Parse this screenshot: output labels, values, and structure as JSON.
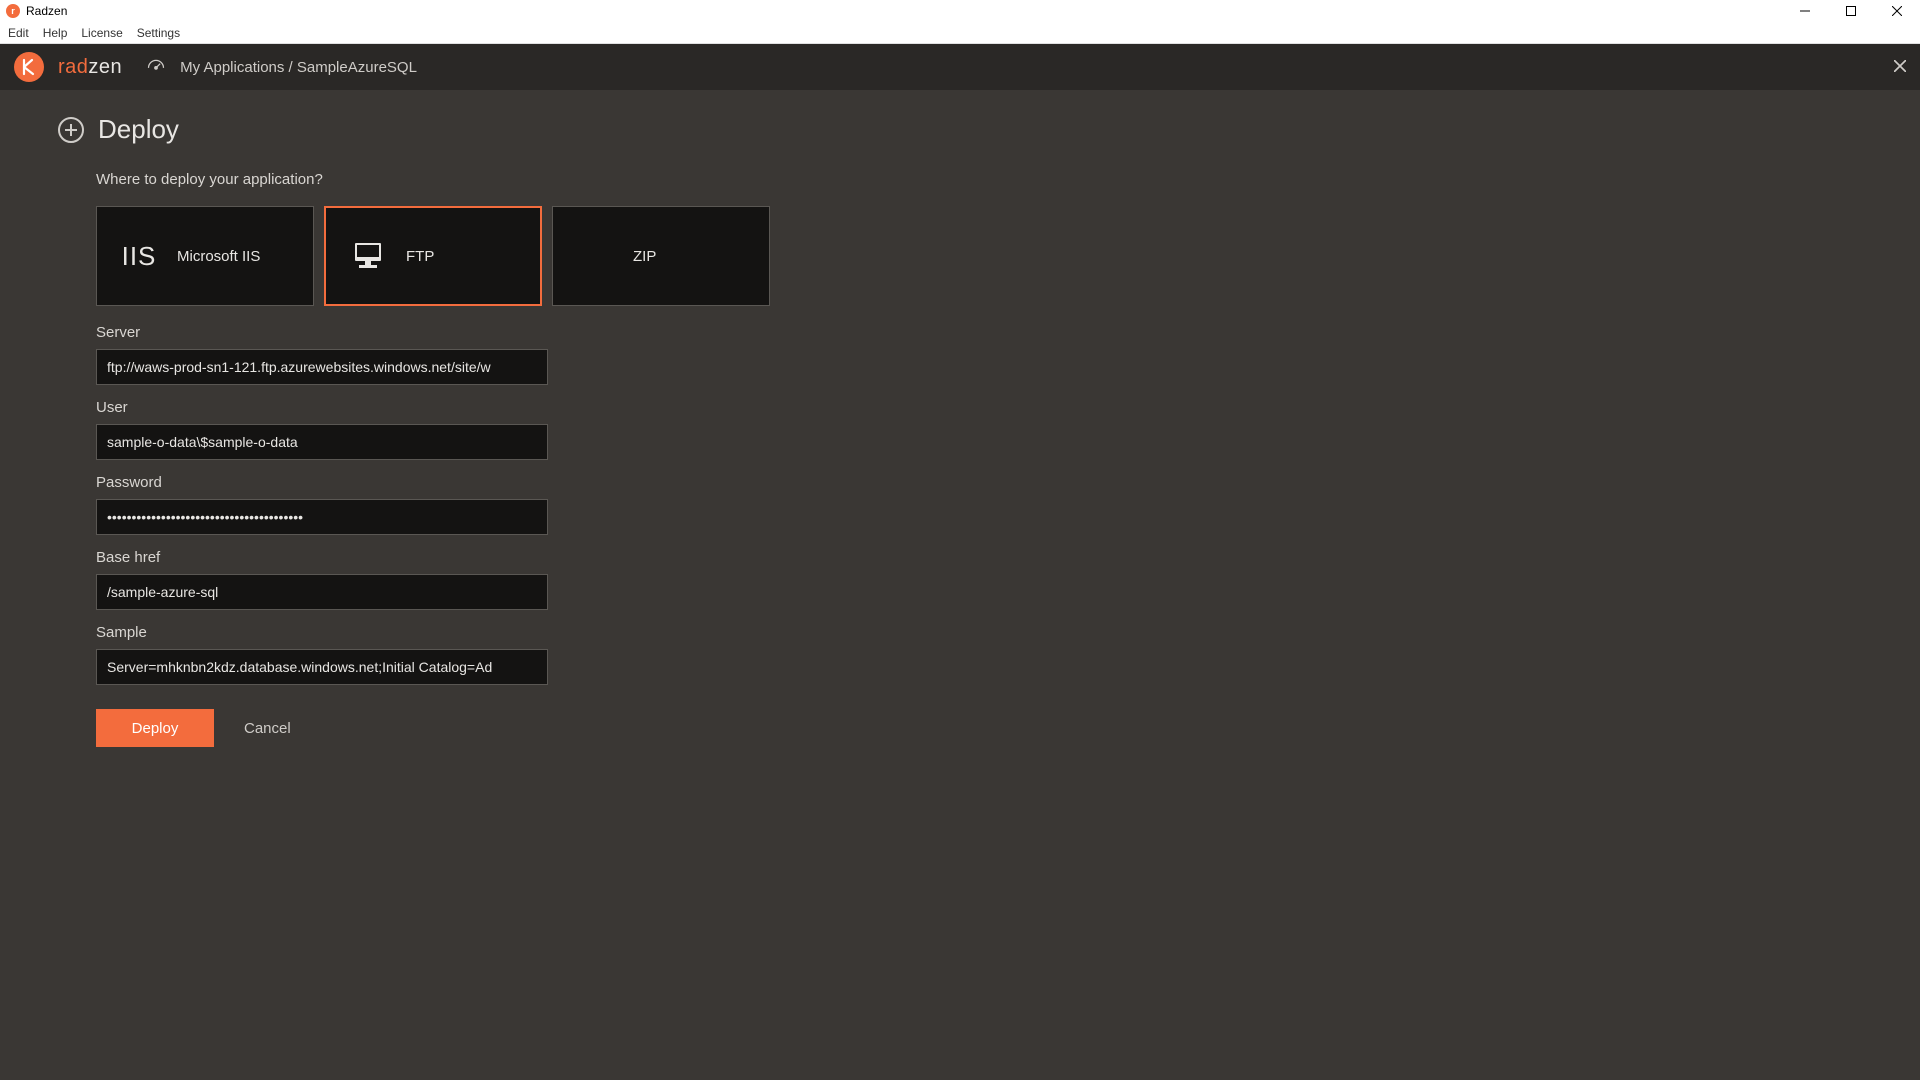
{
  "window": {
    "title": "Radzen"
  },
  "menubar": {
    "items": [
      "Edit",
      "Help",
      "License",
      "Settings"
    ]
  },
  "header": {
    "logo_rad": "rad",
    "logo_zen": "zen",
    "breadcrumb": "My Applications / SampleAzureSQL"
  },
  "page": {
    "title": "Deploy",
    "prompt": "Where to deploy your application?"
  },
  "targets": [
    {
      "id": "iis",
      "label": "Microsoft IIS",
      "selected": false
    },
    {
      "id": "ftp",
      "label": "FTP",
      "selected": true
    },
    {
      "id": "zip",
      "label": "ZIP",
      "selected": false
    }
  ],
  "fields": {
    "server": {
      "label": "Server",
      "value": "ftp://waws-prod-sn1-121.ftp.azurewebsites.windows.net/site/w"
    },
    "user": {
      "label": "User",
      "value": "sample-o-data\\$sample-o-data"
    },
    "password": {
      "label": "Password",
      "value": "••••••••••••••••••••••••••••••••••••••••"
    },
    "basehref": {
      "label": "Base href",
      "value": "/sample-azure-sql"
    },
    "sample": {
      "label": "Sample",
      "value": "Server=mhknbn2kdz.database.windows.net;Initial Catalog=Ad"
    }
  },
  "buttons": {
    "deploy": "Deploy",
    "cancel": "Cancel"
  }
}
